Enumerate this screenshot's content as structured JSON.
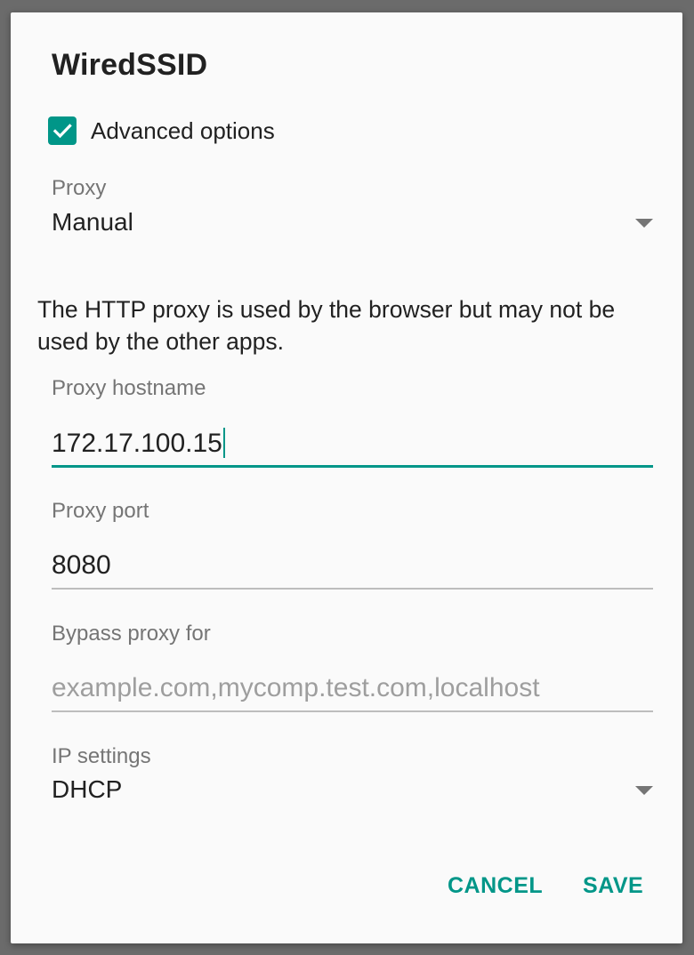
{
  "dialog": {
    "title": "WiredSSID",
    "advanced_options": {
      "label": "Advanced options",
      "checked": true
    },
    "proxy": {
      "label": "Proxy",
      "value": "Manual"
    },
    "info": "The HTTP proxy is used by the browser but may not be used by the other apps.",
    "proxy_hostname": {
      "label": "Proxy hostname",
      "value": "172.17.100.15"
    },
    "proxy_port": {
      "label": "Proxy port",
      "value": "8080"
    },
    "bypass_proxy": {
      "label": "Bypass proxy for",
      "placeholder": "example.com,mycomp.test.com,localhost",
      "value": ""
    },
    "ip_settings": {
      "label": "IP settings",
      "value": "DHCP"
    },
    "buttons": {
      "cancel": "CANCEL",
      "save": "SAVE"
    }
  },
  "colors": {
    "accent": "#009688",
    "text_primary": "#212121",
    "text_secondary": "#757575",
    "hint": "#9e9e9e",
    "divider": "#bdbdbd",
    "background": "#fafafa"
  },
  "icons": {
    "checkbox": "check-icon",
    "dropdown": "dropdown-arrow-icon"
  }
}
